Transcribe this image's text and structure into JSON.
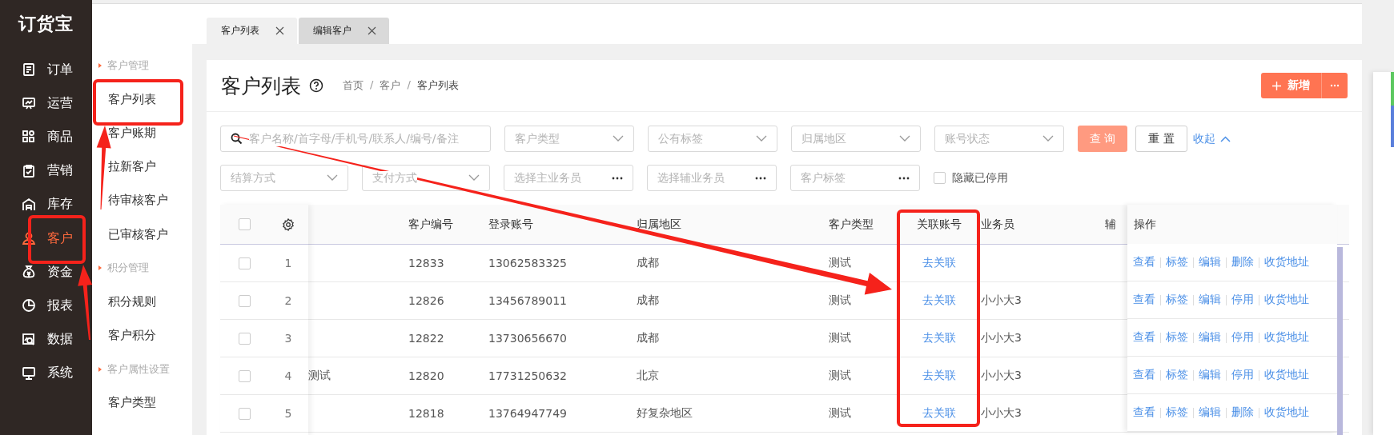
{
  "logo": "订货宝",
  "nav": [
    {
      "label": "订单",
      "selected": false
    },
    {
      "label": "运营",
      "selected": false
    },
    {
      "label": "商品",
      "selected": false
    },
    {
      "label": "营销",
      "selected": false
    },
    {
      "label": "库存",
      "selected": false
    },
    {
      "label": "客户",
      "selected": true
    },
    {
      "label": "资金",
      "selected": false
    },
    {
      "label": "报表",
      "selected": false
    },
    {
      "label": "数据",
      "selected": false
    },
    {
      "label": "系统",
      "selected": false
    }
  ],
  "submenu": [
    {
      "kind": "group",
      "label": "客户管理"
    },
    {
      "kind": "item",
      "label": "客户列表"
    },
    {
      "kind": "item",
      "label": "客户账期"
    },
    {
      "kind": "item",
      "label": "拉新客户"
    },
    {
      "kind": "item",
      "label": "待审核客户"
    },
    {
      "kind": "item",
      "label": "已审核客户"
    },
    {
      "kind": "group",
      "label": "积分管理"
    },
    {
      "kind": "item",
      "label": "积分规则"
    },
    {
      "kind": "item",
      "label": "客户积分"
    },
    {
      "kind": "group",
      "label": "客户属性设置"
    },
    {
      "kind": "item",
      "label": "客户类型"
    }
  ],
  "tabs": [
    {
      "label": "客户列表",
      "selected": true
    },
    {
      "label": "编辑客户",
      "selected": false
    }
  ],
  "page": {
    "title": "客户列表",
    "breadcrumb": [
      "首页",
      "客户",
      "客户列表"
    ],
    "breadcrumb_separator": "/",
    "add_button": "新增"
  },
  "filters": [
    [
      {
        "kind": "search",
        "placeholder": "客户名称/首字母/手机号/联系人/编号/备注"
      },
      {
        "kind": "select",
        "placeholder": "客户类型"
      },
      {
        "kind": "select",
        "placeholder": "公有标签"
      },
      {
        "kind": "select",
        "placeholder": "归属地区"
      },
      {
        "kind": "select",
        "placeholder": "账号状态"
      }
    ],
    [
      {
        "kind": "select",
        "placeholder": "结算方式"
      },
      {
        "kind": "select",
        "placeholder": "支付方式"
      },
      {
        "kind": "picker",
        "placeholder": "选择主业务员"
      },
      {
        "kind": "picker",
        "placeholder": "选择辅业务员"
      },
      {
        "kind": "picker",
        "placeholder": "客户标签"
      }
    ]
  ],
  "query_button": "查 询",
  "reset_button": "重 置",
  "collapse_link": "收起",
  "hide_disabled": {
    "label": "隐藏已停用",
    "checked": false
  },
  "table": {
    "all_checked": false,
    "columns": [
      "客户编号",
      "登录账号",
      "归属地区",
      "客户类型",
      "关联账号",
      "业务员",
      "辅",
      "操作"
    ],
    "rows": [
      {
        "checked": false,
        "index": "1",
        "name": "",
        "code": "12833",
        "account": "13062583325",
        "region": "成都",
        "type": "测试",
        "link": "去关联",
        "salesperson": "",
        "actions": [
          "查看",
          "标签",
          "编辑",
          "删除",
          "收货地址"
        ]
      },
      {
        "checked": false,
        "index": "2",
        "name": "",
        "code": "12826",
        "account": "13456789011",
        "region": "成都",
        "type": "测试",
        "link": "去关联",
        "salesperson": "小小大3",
        "actions": [
          "查看",
          "标签",
          "编辑",
          "停用",
          "收货地址"
        ]
      },
      {
        "checked": false,
        "index": "3",
        "name": "",
        "code": "12822",
        "account": "13730656670",
        "region": "成都",
        "type": "测试",
        "link": "去关联",
        "salesperson": "小小大3",
        "actions": [
          "查看",
          "标签",
          "编辑",
          "停用",
          "收货地址"
        ]
      },
      {
        "checked": false,
        "index": "4",
        "name": "测试",
        "code": "12820",
        "account": "17731250632",
        "region": "北京",
        "type": "测试",
        "link": "去关联",
        "salesperson": "小小大3",
        "actions": [
          "查看",
          "标签",
          "编辑",
          "停用",
          "收货地址"
        ]
      },
      {
        "checked": false,
        "index": "5",
        "name": "",
        "code": "12818",
        "account": "13764947749",
        "region": "好复杂地区",
        "type": "测试",
        "link": "去关联",
        "salesperson": "小小大3",
        "actions": [
          "查看",
          "标签",
          "编辑",
          "删除",
          "收货地址"
        ]
      }
    ]
  }
}
